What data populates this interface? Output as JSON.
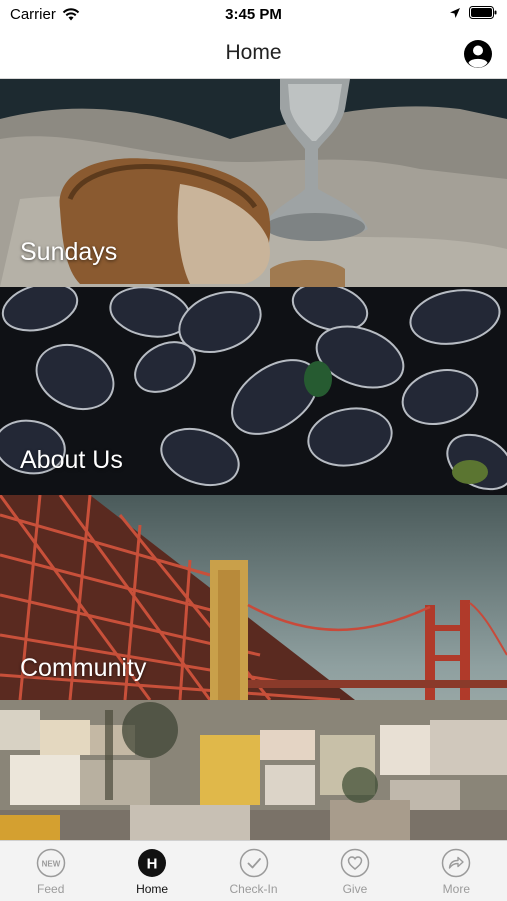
{
  "status_bar": {
    "carrier": "Carrier",
    "time": "3:45 PM"
  },
  "nav": {
    "title": "Home"
  },
  "cards": [
    {
      "label": "Sundays"
    },
    {
      "label": "About Us"
    },
    {
      "label": "Community"
    }
  ],
  "tabs": [
    {
      "label": "Feed",
      "icon": "new-badge-icon",
      "active": false
    },
    {
      "label": "Home",
      "icon": "home-h-icon",
      "active": true
    },
    {
      "label": "Check-In",
      "icon": "checkmark-circle-icon",
      "active": false
    },
    {
      "label": "Give",
      "icon": "heart-circle-icon",
      "active": false
    },
    {
      "label": "More",
      "icon": "share-arrow-icon",
      "active": false
    }
  ],
  "colors": {
    "active_tab": "#111111",
    "inactive_tab": "#9b9b9b",
    "tab_bar_bg": "#f3f3f3"
  }
}
